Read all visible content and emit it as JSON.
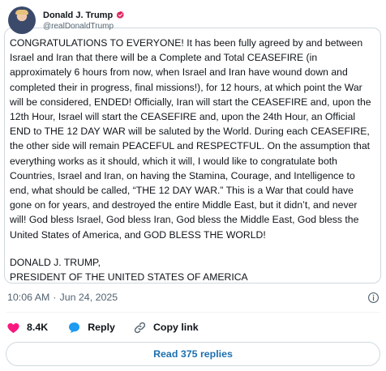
{
  "author": {
    "display_name": "Donald J. Trump",
    "handle": "@realDonaldTrump"
  },
  "tweet": {
    "text": "CONGRATULATIONS TO EVERYONE! It has been fully agreed by and between\nIsrael and Iran that there will be a Complete and Total CEASEFIRE (in\napproximately 6 hours from now, when Israel and Iran have wound down and\ncompleted their in progress, final missions!), for 12 hours, at which point the War\nwill be considered, ENDED! Officially, Iran will start the CEASEFIRE and, upon the\n12th Hour, Israel will start the CEASEFIRE and, upon the 24th Hour, an Official\nEND to THE 12 DAY WAR will be saluted by the World. During each CEASEFIRE,\nthe other side will remain PEACEFUL and RESPECTFUL. On the assumption that\neverything works as it should, which it will, I would like to congratulate both\nCountries, Israel and Iran, on having the Stamina, Courage, and Intelligence to\nend, what should be called, “THE 12 DAY WAR.” This is a War that could have\ngone on for years, and destroyed the entire Middle East, but it didn’t, and never\nwill! God bless Israel, God bless Iran, God bless the Middle East, God bless the\nUnited States of America, and GOD BLESS THE WORLD!",
    "signature": "DONALD J. TRUMP,\nPRESIDENT OF THE UNITED STATES OF AMERICA"
  },
  "meta": {
    "time": "10:06 AM",
    "separator": "·",
    "date": "Jun 24, 2025"
  },
  "actions": {
    "like_count": "8.4K",
    "reply_label": "Reply",
    "copy_link_label": "Copy link"
  },
  "replies_button": {
    "label": "Read 375 replies"
  },
  "colors": {
    "like": "#f91880",
    "reply": "#1d9bf0",
    "verified": "#e0245e",
    "link": "#1d6fb0"
  }
}
